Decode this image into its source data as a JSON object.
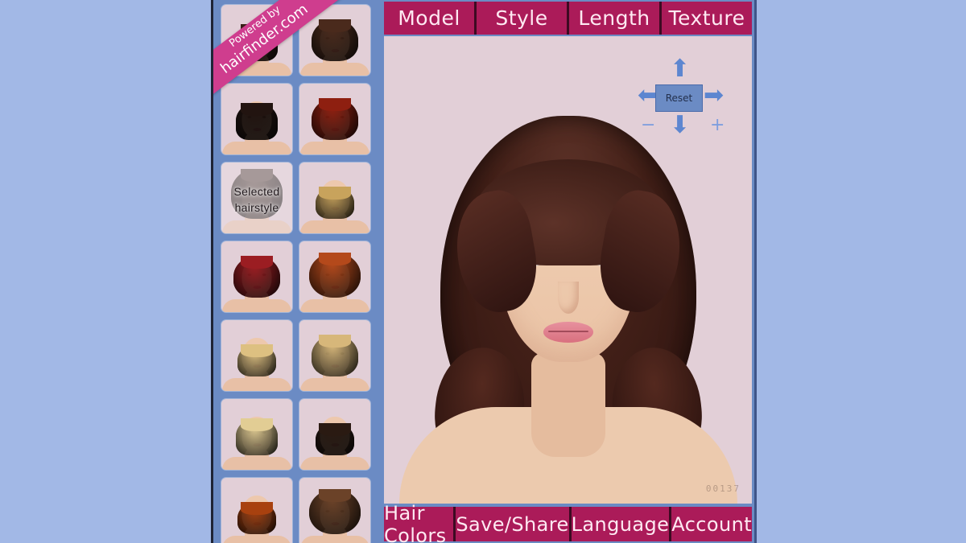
{
  "app": {
    "ribbon": {
      "line1": "Powered by",
      "line2": "hairfinder.com"
    },
    "watermark": "00137"
  },
  "tabs": [
    {
      "label": "Model"
    },
    {
      "label": "Style"
    },
    {
      "label": "Length"
    },
    {
      "label": "Texture"
    }
  ],
  "bottom_bar": [
    {
      "label": "Hair Colors"
    },
    {
      "label": "Save/Share"
    },
    {
      "label": "Language"
    },
    {
      "label": "Account"
    }
  ],
  "nav_controls": {
    "reset_label": "Reset",
    "up": "⬆",
    "down": "⬇",
    "left": "⬅",
    "right": "➡",
    "zoom_out": "−",
    "zoom_in": "+"
  },
  "selected_thumbnail_label": "Selected\nhairstyle",
  "thumbnails": [
    {
      "id": 1,
      "hair_color": "#3a2018",
      "hair_shape": "h-bob",
      "selected": false,
      "label": ""
    },
    {
      "id": 2,
      "hair_color": "#4a2a1c",
      "hair_shape": "h-med",
      "selected": false,
      "label": ""
    },
    {
      "id": 3,
      "hair_color": "#221410",
      "hair_shape": "h-bob",
      "selected": false,
      "label": ""
    },
    {
      "id": 4,
      "hair_color": "#8e1f10",
      "hair_shape": "h-med",
      "selected": false,
      "label": ""
    },
    {
      "id": 5,
      "hair_color": "#55463e",
      "hair_shape": "h-long",
      "selected": true,
      "label": "Selected hairstyle"
    },
    {
      "id": 6,
      "hair_color": "#c8a35c",
      "hair_shape": "h-short",
      "selected": false,
      "label": ""
    },
    {
      "id": 7,
      "hair_color": "#9b1d22",
      "hair_shape": "h-med",
      "selected": false,
      "label": ""
    },
    {
      "id": 8,
      "hair_color": "#b4491b",
      "hair_shape": "h-curly",
      "selected": false,
      "label": ""
    },
    {
      "id": 9,
      "hair_color": "#ddc081",
      "hair_shape": "h-short",
      "selected": false,
      "label": ""
    },
    {
      "id": 10,
      "hair_color": "#d7b77a",
      "hair_shape": "h-med",
      "selected": false,
      "label": ""
    },
    {
      "id": 11,
      "hair_color": "#e2cd94",
      "hair_shape": "h-bob",
      "selected": false,
      "label": ""
    },
    {
      "id": 12,
      "hair_color": "#2a1a12",
      "hair_shape": "h-short",
      "selected": false,
      "label": ""
    },
    {
      "id": 13,
      "hair_color": "#a8410f",
      "hair_shape": "h-short",
      "selected": false,
      "label": ""
    },
    {
      "id": 14,
      "hair_color": "#6b4228",
      "hair_shape": "h-curly",
      "selected": false,
      "label": ""
    }
  ],
  "colors": {
    "page_background": "#a2b8e6",
    "panel_blue": "#6b8bc4",
    "canvas_pink": "#e2cfd7",
    "accent_magenta": "#ab1b59",
    "accent_dark": "#3d0a22",
    "ribbon_pink": "#cf3d8e",
    "arrow_blue": "#5d86d0"
  }
}
